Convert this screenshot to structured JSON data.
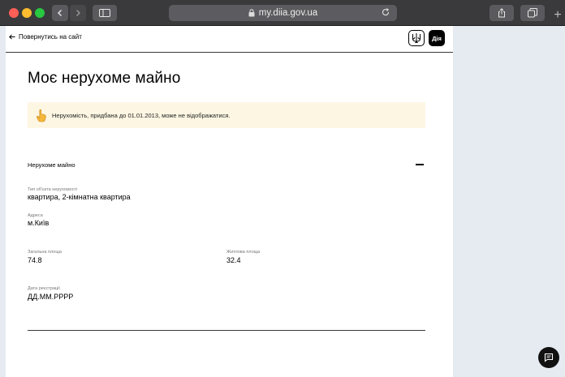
{
  "browser": {
    "url": "my.diia.gov.ua",
    "icons": [
      "back-icon",
      "forward-icon",
      "sidebar-icon",
      "lock-icon",
      "reload-icon",
      "share-icon",
      "tabs-icon",
      "plus-icon"
    ],
    "new_tab_label": "+"
  },
  "header": {
    "back_label": "Повернутись на сайт",
    "logo_text": "Дія"
  },
  "main": {
    "title": "Моє нерухоме майно",
    "notice": "Нерухомість, придбана до 01.01.2013, може не відображатися.",
    "section_title": "Нерухоме майно",
    "fields": {
      "object_type": {
        "label": "Тип об'єкта нерухомості",
        "value": "квартира, 2-кімнатна квартира"
      },
      "address": {
        "label": "Адреса",
        "value": "м.Київ"
      },
      "total_area": {
        "label": "Загальна площа",
        "value": "74.8"
      },
      "living_area": {
        "label": "Житлова площа",
        "value": "32.4"
      },
      "registration_date": {
        "label": "Дата реєстрації",
        "value": "ДД.ММ.РРРР"
      }
    }
  },
  "colors": {
    "notice_bg": "#fdf6e3",
    "page_bg": "#ffffff",
    "side_bg": "#e6ebf2",
    "chrome": "#3a3a3c"
  }
}
